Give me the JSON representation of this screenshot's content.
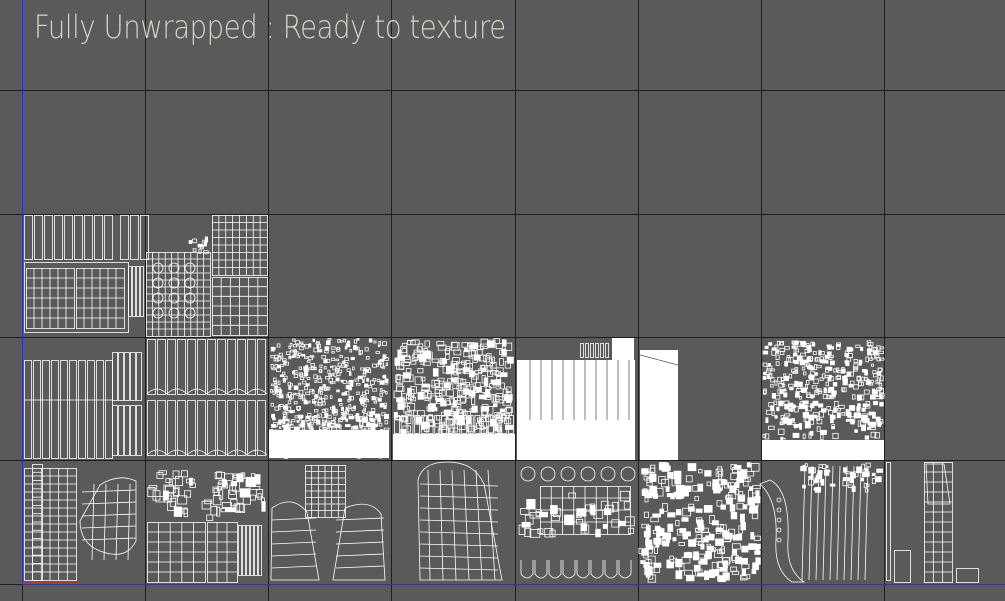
{
  "viewport": {
    "title": "Fully Unwrapped : Ready to texture",
    "background_color": "#5a5a5a",
    "grid_color": "#1e1e1e",
    "uv_line_color": "#ffffff",
    "axis_v_color": "#3030c8",
    "axis_h_color": "#3030c8",
    "axis_origin_mark_color": "#c83030"
  }
}
